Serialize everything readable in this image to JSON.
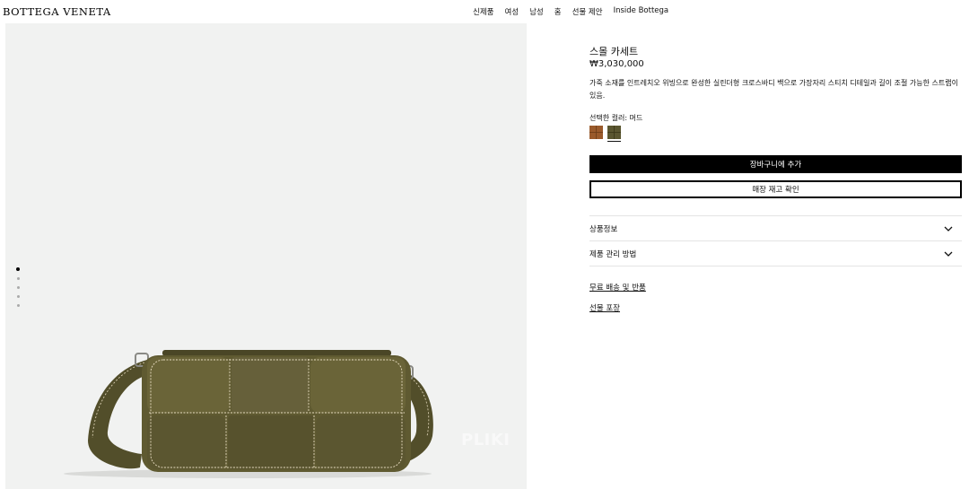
{
  "header": {
    "logo": "BOTTEGA VENETA",
    "nav": [
      "신제품",
      "여성",
      "남성",
      "홈",
      "선물 제안",
      "Inside Bottega"
    ]
  },
  "gallery": {
    "image_count": 5,
    "active_index": 0,
    "watermark": "PLIKI"
  },
  "product": {
    "title": "스몰 카세트",
    "price": "₩3,030,000",
    "description": "가죽 소재를 인트레치오 위빙으로 완성한 실린더형 크로스바디 백으로 가장자리 스티치 디테일과 길이 조절 가능한 스트랩이 있음.",
    "color_label": "선택한 컬러: 머드",
    "swatches": [
      {
        "name": "tan",
        "color": "#9a5a2b",
        "selected": false
      },
      {
        "name": "mud",
        "color": "#5a5630",
        "selected": true
      }
    ],
    "add_to_cart": "장바구니에 추가",
    "check_stock": "매장 재고 확인",
    "accordion": [
      "상품정보",
      "제품 관리 방법"
    ],
    "links": [
      "무료 배송 및 반품",
      "선물 포장"
    ]
  },
  "colors": {
    "image_bg": "#f1f2f1",
    "bag_leather": "#5f5a31",
    "stitch": "#e7dcc0"
  }
}
